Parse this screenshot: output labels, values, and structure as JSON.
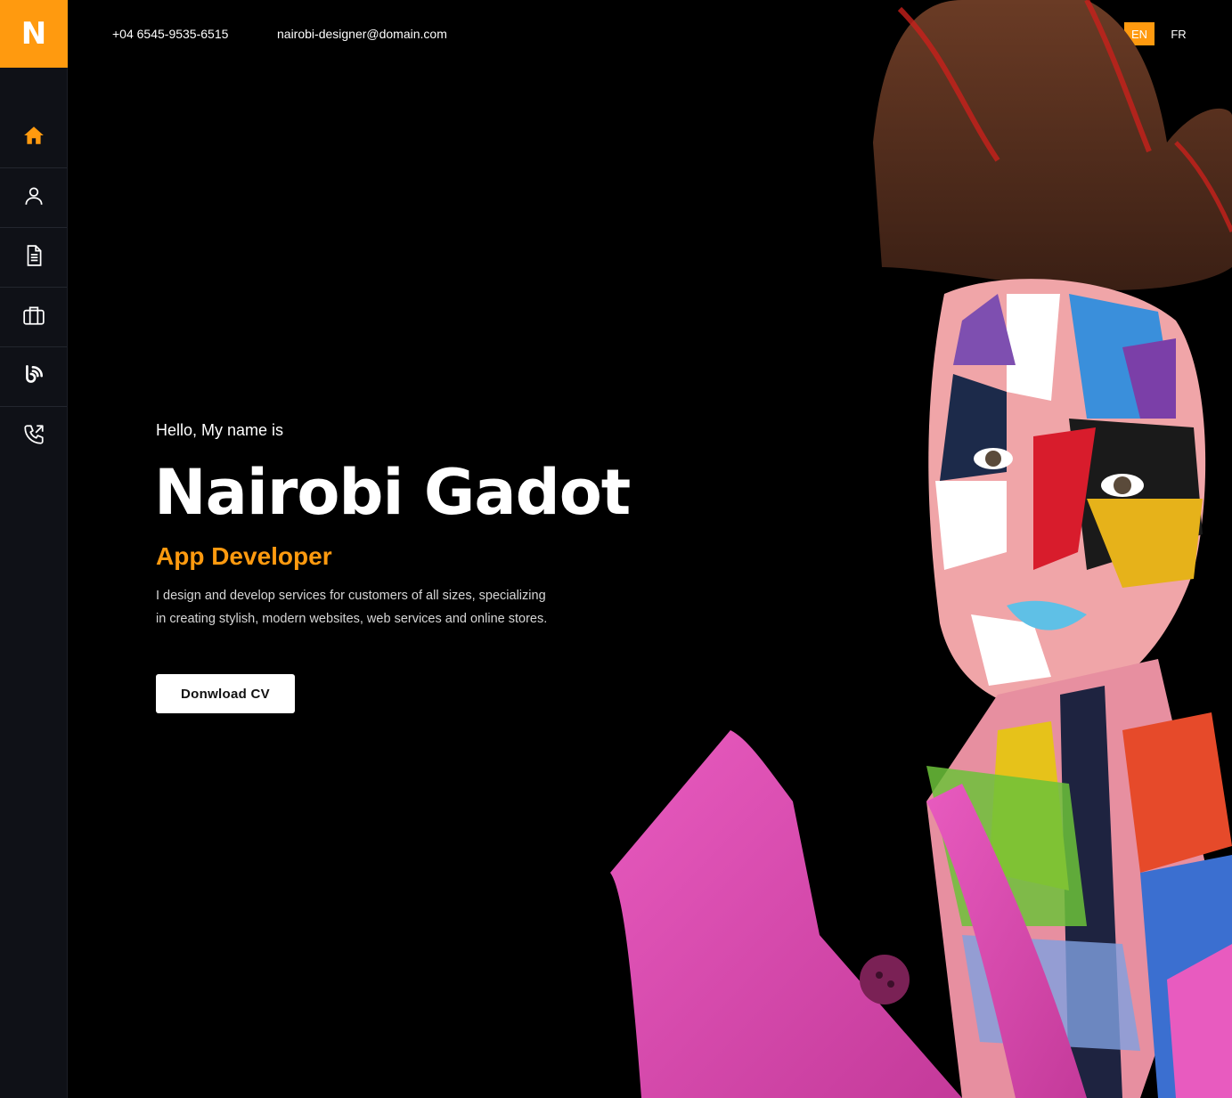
{
  "logo": {
    "letter": "N"
  },
  "header": {
    "phone": "+04 6545-9535-6515",
    "email": "nairobi-designer@domain.com",
    "languages": [
      {
        "code": "EN",
        "active": true
      },
      {
        "code": "FR",
        "active": false
      }
    ]
  },
  "sidebar": {
    "items": [
      {
        "icon": "home-icon",
        "active": true
      },
      {
        "icon": "user-icon",
        "active": false
      },
      {
        "icon": "document-icon",
        "active": false
      },
      {
        "icon": "briefcase-icon",
        "active": false
      },
      {
        "icon": "rss-icon",
        "active": false
      },
      {
        "icon": "phone-icon",
        "active": false
      }
    ]
  },
  "hero": {
    "greeting": "Hello, My name is",
    "name": "Nairobi Gadot",
    "role": "App Developer",
    "description": "I design and develop services for customers of all sizes, specializing in creating stylish, modern websites, web services and online stores.",
    "cta_label": "Donwload CV"
  },
  "colors": {
    "accent": "#ff9a0f",
    "background": "#000000",
    "sidebar": "#0f1117"
  }
}
